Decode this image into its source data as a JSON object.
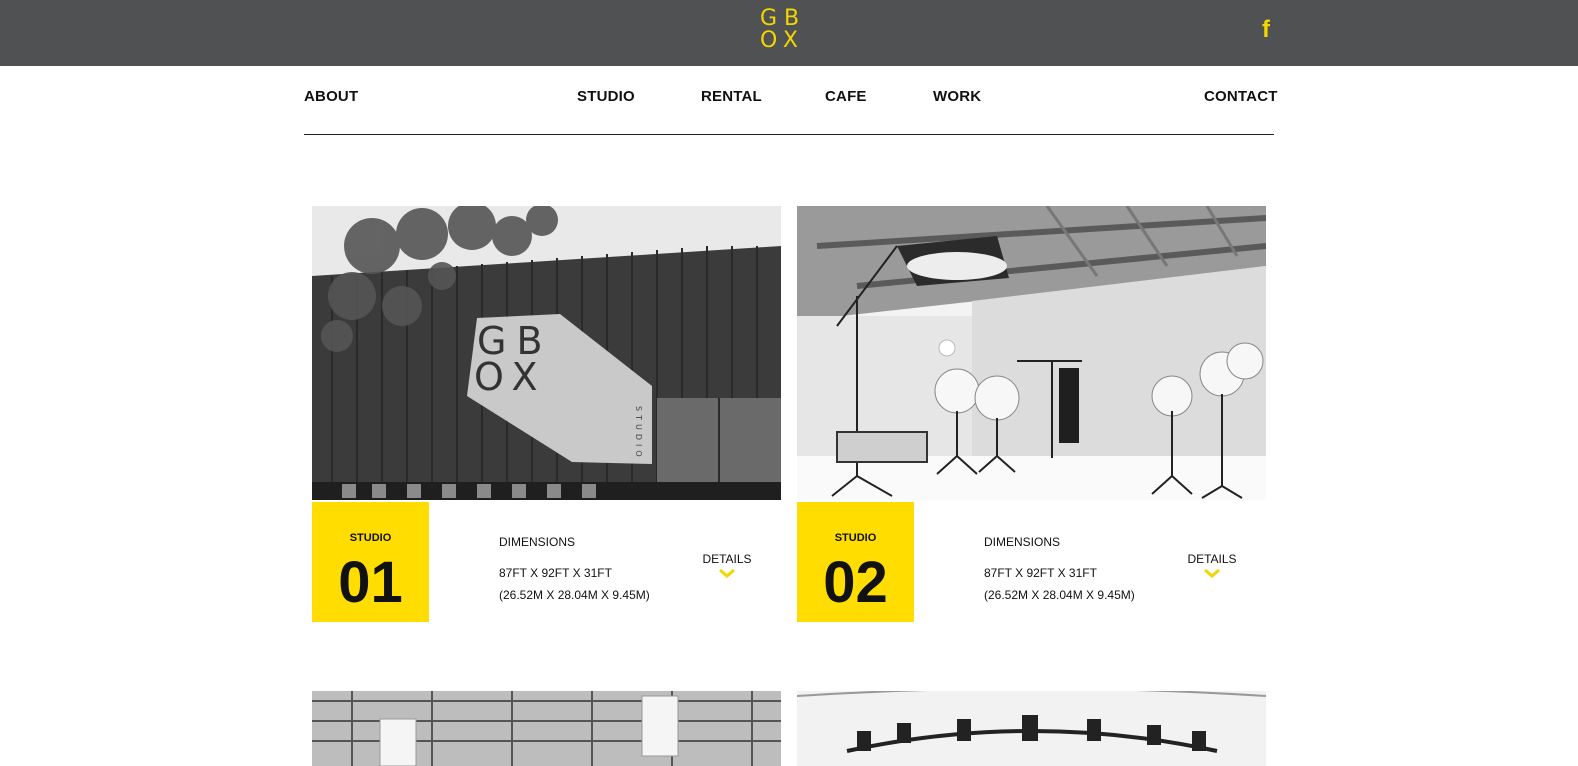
{
  "header": {
    "logo_text": "GBOX",
    "logo_line1": "GB",
    "logo_line2": "OX",
    "facebook_glyph": "f",
    "accent_color": "#ffdd00",
    "bar_color": "#505153"
  },
  "nav": {
    "items": [
      {
        "label": "ABOUT"
      },
      {
        "label": "STUDIO"
      },
      {
        "label": "RENTAL"
      },
      {
        "label": "CAFE"
      },
      {
        "label": "WORK"
      },
      {
        "label": "CONTACT"
      }
    ]
  },
  "studios": [
    {
      "label": "STUDIO",
      "number": "01",
      "dimensions_title": "DIMENSIONS",
      "dimensions_ft": "87FT X 92FT X 31FT",
      "dimensions_m": "(26.52M X 28.04M X 9.45M)",
      "details_label": "DETAILS",
      "sign_line1": "GB",
      "sign_line2": "OX",
      "sign_vertical": "STUDIO"
    },
    {
      "label": "STUDIO",
      "number": "02",
      "dimensions_title": "DIMENSIONS",
      "dimensions_ft": "87FT X 92FT X 31FT",
      "dimensions_m": "(26.52M X 28.04M X 9.45M)",
      "details_label": "DETAILS"
    }
  ],
  "icons": {
    "facebook": "facebook-icon",
    "chevron": "chevron-down-icon"
  }
}
